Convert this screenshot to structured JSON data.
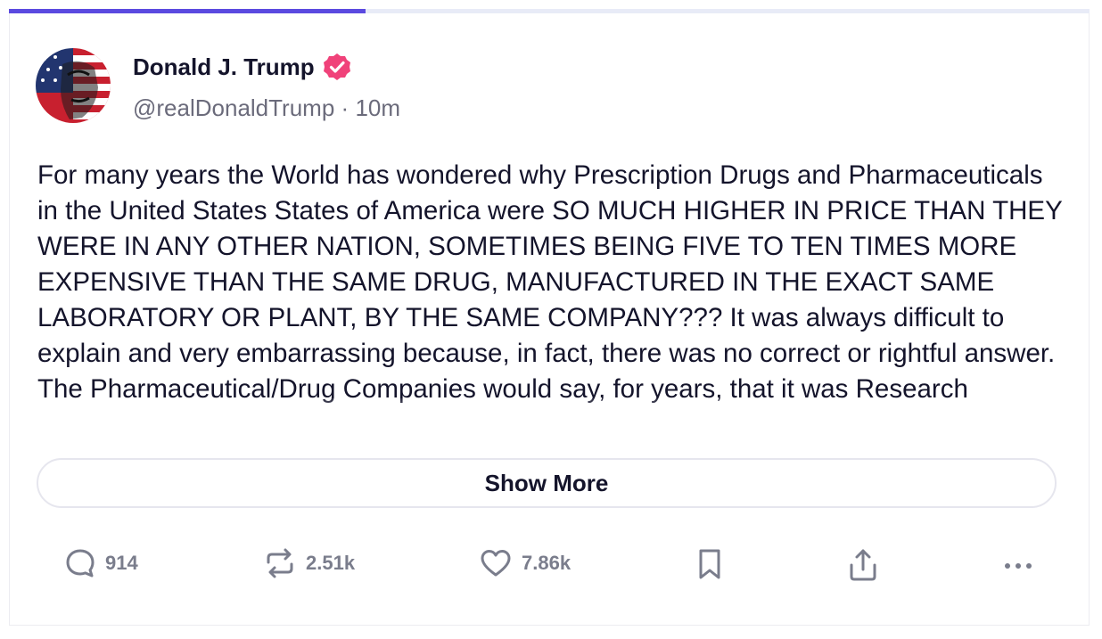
{
  "progress": {
    "fraction": 0.33,
    "fill_color": "#5b4ae0",
    "track_color": "#e8ebf7"
  },
  "post": {
    "author_name": "Donald J. Trump",
    "verified_icon": "verified-badge-icon",
    "verified_color": "#f0427a",
    "handle": "@realDonaldTrump",
    "separator": "·",
    "time": "10m",
    "text": "For many years the World has wondered why Prescription Drugs and Pharmaceuticals in the United States States of America were SO MUCH HIGHER IN PRICE THAN THEY WERE IN ANY OTHER NATION, SOMETIMES BEING FIVE TO TEN TIMES MORE EXPENSIVE THAN THE SAME DRUG, MANUFACTURED IN THE EXACT SAME LABORATORY OR PLANT, BY THE SAME COMPANY??? It was always difficult to explain and very embarrassing because, in fact, there was no correct or rightful answer. The Pharmaceutical/Drug Companies would say, for years, that it was Research",
    "show_more_label": "Show More"
  },
  "actions": {
    "replies": {
      "icon": "reply-icon",
      "count": "914"
    },
    "retruths": {
      "icon": "repost-icon",
      "count": "2.51k"
    },
    "likes": {
      "icon": "heart-icon",
      "count": "7.86k"
    },
    "bookmark": {
      "icon": "bookmark-icon"
    },
    "share": {
      "icon": "share-icon"
    },
    "more": {
      "icon": "more-icon"
    }
  }
}
